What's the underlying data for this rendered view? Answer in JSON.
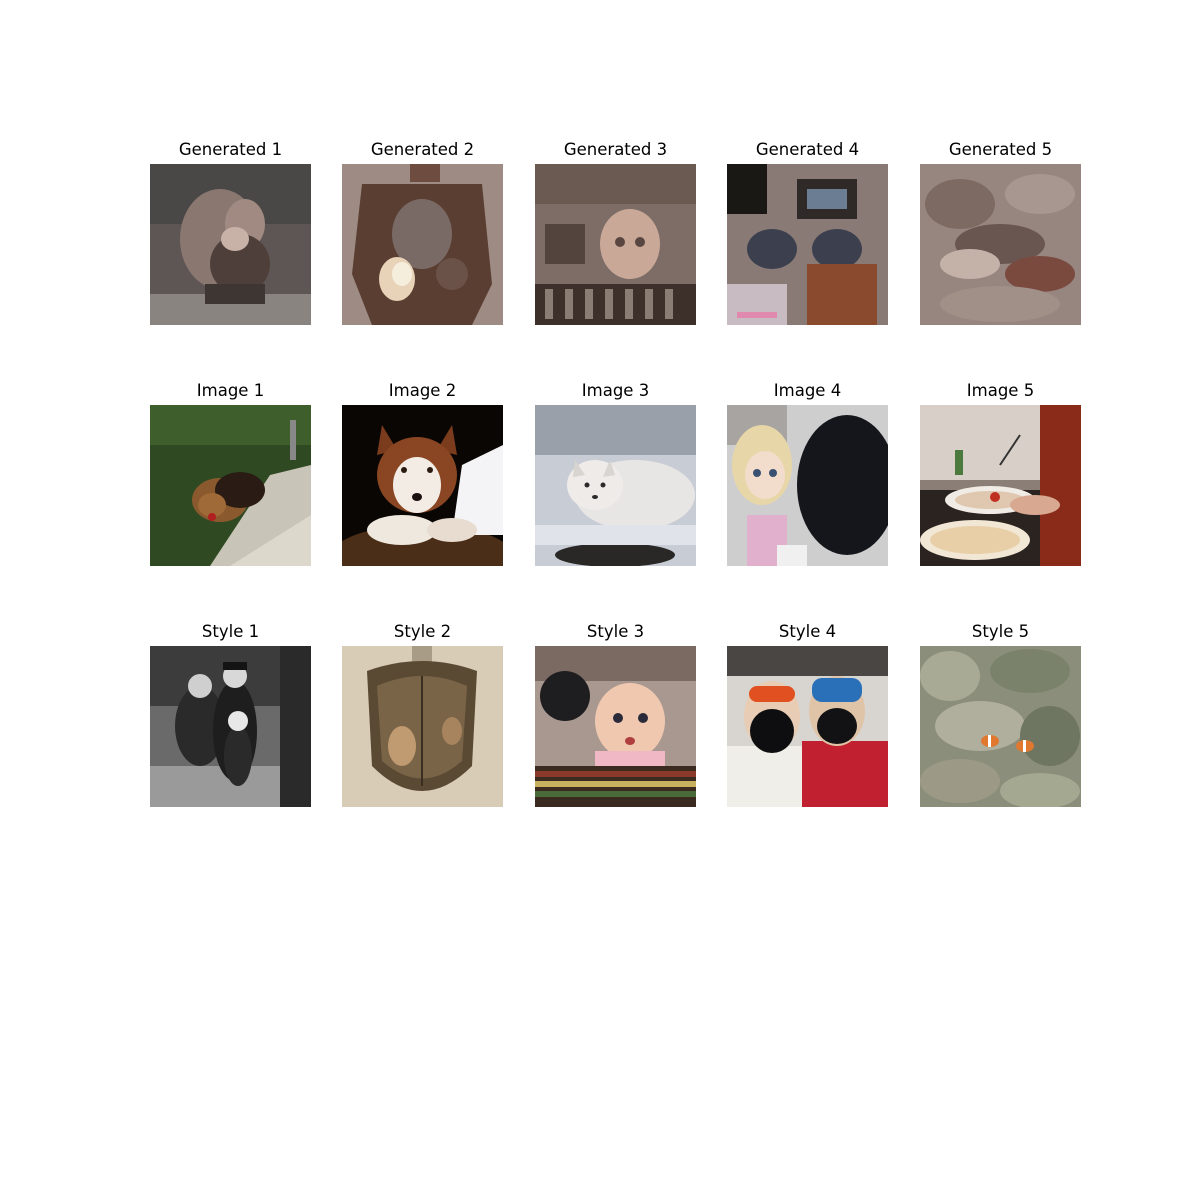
{
  "rows": [
    {
      "row_name": "generated",
      "panels": [
        {
          "title": "Generated 1",
          "subject": "blurry figure of a person with a dark bag"
        },
        {
          "title": "Generated 2",
          "subject": "blurry brownish armor-like shape"
        },
        {
          "title": "Generated 3",
          "subject": "blurry child face with striped foreground"
        },
        {
          "title": "Generated 4",
          "subject": "blurry figure with blue goggles"
        },
        {
          "title": "Generated 5",
          "subject": "blurry textured reef pattern"
        }
      ]
    },
    {
      "row_name": "image",
      "panels": [
        {
          "title": "Image 1",
          "subject": "small brown dog walking on a path"
        },
        {
          "title": "Image 2",
          "subject": "husky dog lying on a bed"
        },
        {
          "title": "Image 3",
          "subject": "white arctic fox in snow"
        },
        {
          "title": "Image 4",
          "subject": "doll next to a black dog"
        },
        {
          "title": "Image 5",
          "subject": "plates of food in a kitchen"
        }
      ]
    },
    {
      "row_name": "style",
      "panels": [
        {
          "title": "Style 1",
          "subject": "black and white family photo"
        },
        {
          "title": "Style 2",
          "subject": "metal breastplate armor"
        },
        {
          "title": "Style 3",
          "subject": "baby holding a lid"
        },
        {
          "title": "Style 4",
          "subject": "two people in ski masks and goggles"
        },
        {
          "title": "Style 5",
          "subject": "clownfish in sea anemone"
        }
      ]
    }
  ]
}
